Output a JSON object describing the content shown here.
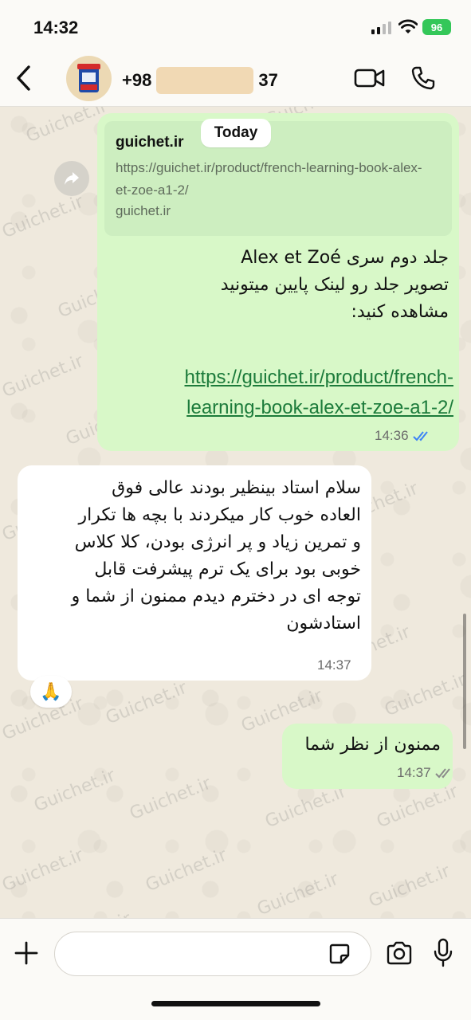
{
  "status_bar": {
    "time": "14:32",
    "battery": "96"
  },
  "header": {
    "name_prefix": "+98",
    "name_suffix": "37"
  },
  "date_separator": "Today",
  "messages": [
    {
      "direction": "outgoing",
      "link_preview": {
        "title": "guichet.ir",
        "url": "https://guichet.ir/product/french-learning-book-alex-et-zoe-a1-2/",
        "domain": "guichet.ir"
      },
      "lines": [
        "جلد دوم سری Alex et Zoé",
        "تصویر جلد رو لینک پایین میتونید",
        "مشاهده کنید:"
      ],
      "link_lines": [
        "https://guichet.ir/product/french-",
        "learning-book-alex-et-zoe-a1-2/"
      ],
      "time": "14:36",
      "status": "read"
    },
    {
      "direction": "incoming",
      "lines": [
        "سلام استاد بینظیر بودند عالی فوق",
        "العاده خوب کار میکردند با بچه ها تکرار",
        "و تمرین زیاد و پر انرژی بودن، کلا کلاس",
        "خوبی بود برای یک ترم پیشرفت قابل",
        "توجه ای در دخترم دیدم ممنون از شما و",
        "استادشون"
      ],
      "time": "14:37",
      "reaction": "🙏"
    },
    {
      "direction": "outgoing",
      "lines": [
        "ممنون از نظر شما"
      ],
      "time": "14:37",
      "status": "delivered"
    }
  ],
  "watermark": "Guichet.ir",
  "colors": {
    "outgoing_bubble": "#d8f8c8",
    "incoming_bubble": "#ffffff",
    "link": "#1c7b3b",
    "read_tick": "#3b82f6"
  }
}
